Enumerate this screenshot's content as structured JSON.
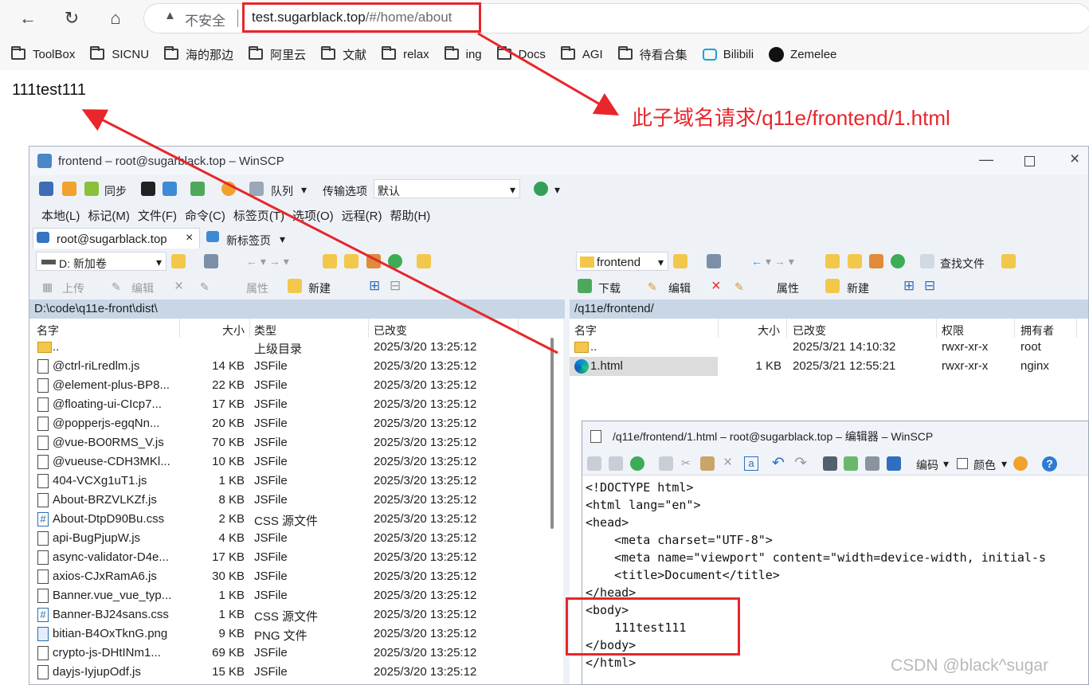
{
  "browser": {
    "insecure_label": "不安全",
    "url_host": "test.sugarblack.top",
    "url_path": "/#/home/about",
    "bookmarks": [
      "ToolBox",
      "SICNU",
      "海的那边",
      "阿里云",
      "文献",
      "relax",
      "ing",
      "Docs",
      "AGI",
      "待看合集",
      "Bilibili",
      "Zemelee"
    ]
  },
  "page": {
    "body_text": "111test111",
    "annotation": "此子域名请求/q11e/frontend/1.html"
  },
  "winscp": {
    "title": "frontend – root@sugarblack.top – WinSCP",
    "toolbar": {
      "sync": "同步",
      "queue": "队列",
      "transfer_options": "传输选项",
      "transfer_default": "默认"
    },
    "menu": [
      "本地(L)",
      "标记(M)",
      "文件(F)",
      "命令(C)",
      "标签页(T)",
      "选项(O)",
      "远程(R)",
      "帮助(H)"
    ],
    "tabs": {
      "active": "root@sugarblack.top",
      "new": "新标签页"
    },
    "local": {
      "drive": "D: 新加卷",
      "actions": {
        "upload": "上传",
        "edit": "编辑",
        "props": "属性",
        "new": "新建"
      },
      "path": "D:\\code\\q11e-front\\dist\\",
      "columns": {
        "name": "名字",
        "size": "大小",
        "type": "类型",
        "changed": "已改变"
      },
      "rows": [
        {
          "name": "..",
          "size": "",
          "type": "上级目录",
          "changed": "2025/3/20 13:25:12",
          "icon": "updir"
        },
        {
          "name": "@ctrl-riLredlm.js",
          "size": "14 KB",
          "type": "JSFile",
          "changed": "2025/3/20 13:25:12",
          "icon": "file"
        },
        {
          "name": "@element-plus-BP8...",
          "size": "22 KB",
          "type": "JSFile",
          "changed": "2025/3/20 13:25:12",
          "icon": "file"
        },
        {
          "name": "@floating-ui-CIcp7...",
          "size": "17 KB",
          "type": "JSFile",
          "changed": "2025/3/20 13:25:12",
          "icon": "file"
        },
        {
          "name": "@popperjs-egqNn...",
          "size": "20 KB",
          "type": "JSFile",
          "changed": "2025/3/20 13:25:12",
          "icon": "file"
        },
        {
          "name": "@vue-BO0RMS_V.js",
          "size": "70 KB",
          "type": "JSFile",
          "changed": "2025/3/20 13:25:12",
          "icon": "file"
        },
        {
          "name": "@vueuse-CDH3MKl...",
          "size": "10 KB",
          "type": "JSFile",
          "changed": "2025/3/20 13:25:12",
          "icon": "file"
        },
        {
          "name": "404-VCXg1uT1.js",
          "size": "1 KB",
          "type": "JSFile",
          "changed": "2025/3/20 13:25:12",
          "icon": "file"
        },
        {
          "name": "About-BRZVLKZf.js",
          "size": "8 KB",
          "type": "JSFile",
          "changed": "2025/3/20 13:25:12",
          "icon": "file"
        },
        {
          "name": "About-DtpD90Bu.css",
          "size": "2 KB",
          "type": "CSS 源文件",
          "changed": "2025/3/20 13:25:12",
          "icon": "css"
        },
        {
          "name": "api-BugPjupW.js",
          "size": "4 KB",
          "type": "JSFile",
          "changed": "2025/3/20 13:25:12",
          "icon": "file"
        },
        {
          "name": "async-validator-D4e...",
          "size": "17 KB",
          "type": "JSFile",
          "changed": "2025/3/20 13:25:12",
          "icon": "file"
        },
        {
          "name": "axios-CJxRamA6.js",
          "size": "30 KB",
          "type": "JSFile",
          "changed": "2025/3/20 13:25:12",
          "icon": "file"
        },
        {
          "name": "Banner.vue_vue_typ...",
          "size": "1 KB",
          "type": "JSFile",
          "changed": "2025/3/20 13:25:12",
          "icon": "file"
        },
        {
          "name": "Banner-BJ24sans.css",
          "size": "1 KB",
          "type": "CSS 源文件",
          "changed": "2025/3/20 13:25:12",
          "icon": "css"
        },
        {
          "name": "bitian-B4OxTknG.png",
          "size": "9 KB",
          "type": "PNG 文件",
          "changed": "2025/3/20 13:25:12",
          "icon": "png"
        },
        {
          "name": "crypto-js-DHtINm1...",
          "size": "69 KB",
          "type": "JSFile",
          "changed": "2025/3/20 13:25:12",
          "icon": "file"
        },
        {
          "name": "dayjs-IyjupOdf.js",
          "size": "15 KB",
          "type": "JSFile",
          "changed": "2025/3/20 13:25:12",
          "icon": "file"
        }
      ]
    },
    "remote": {
      "dir": "frontend",
      "find": "查找文件",
      "actions": {
        "download": "下载",
        "edit": "编辑",
        "props": "属性",
        "new": "新建"
      },
      "path": "/q11e/frontend/",
      "columns": {
        "name": "名字",
        "size": "大小",
        "changed": "已改变",
        "perm": "权限",
        "owner": "拥有者"
      },
      "rows": [
        {
          "name": "..",
          "size": "",
          "changed": "2025/3/21 14:10:32",
          "perm": "rwxr-xr-x",
          "owner": "root",
          "icon": "updir"
        },
        {
          "name": "1.html",
          "size": "1 KB",
          "changed": "2025/3/21 12:55:21",
          "perm": "rwxr-xr-x",
          "owner": "nginx",
          "icon": "edge"
        }
      ]
    },
    "editor": {
      "title": "/q11e/frontend/1.html – root@sugarblack.top – 编辑器 – WinSCP",
      "encoding": "编码",
      "color": "颜色",
      "lines": [
        "<!DOCTYPE html>",
        "<html lang=\"en\">",
        "<head>",
        "    <meta charset=\"UTF-8\">",
        "    <meta name=\"viewport\" content=\"width=device-width, initial-s",
        "    <title>Document</title>",
        "</head>",
        "<body>",
        "    111test111",
        "</body>",
        "</html>"
      ]
    }
  },
  "watermark": "CSDN @black^sugar",
  "colors": {
    "accent_red": "#e8262b",
    "path_bar": "#c8d6e6"
  }
}
